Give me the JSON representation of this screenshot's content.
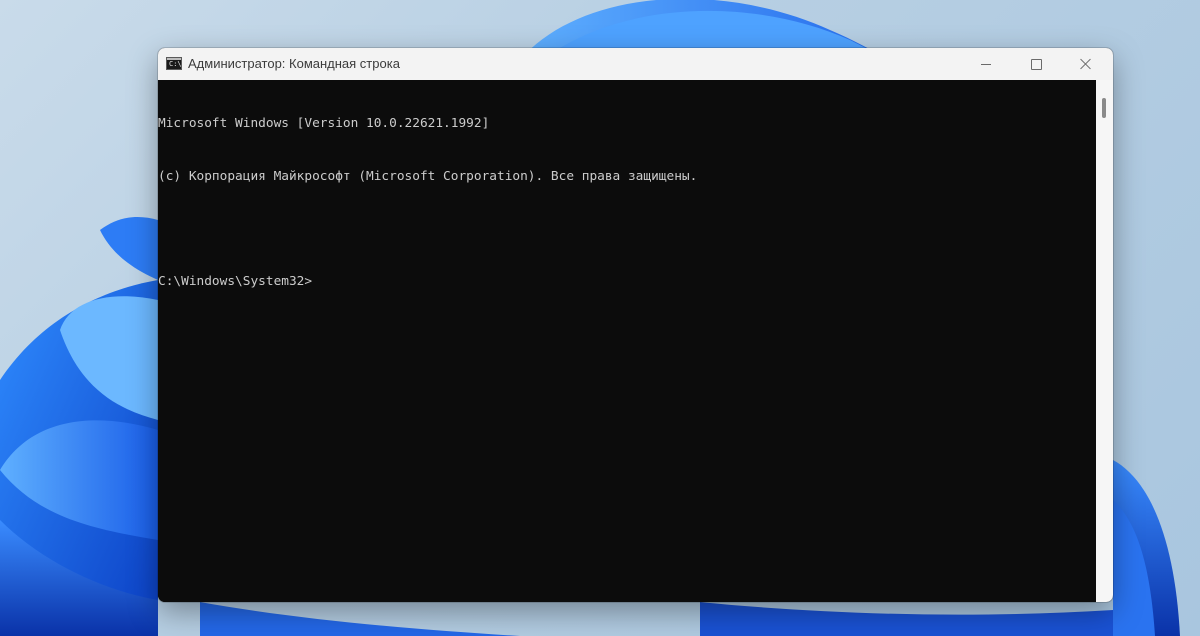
{
  "colors": {
    "console_bg": "#0c0c0c",
    "console_text": "#cccccc",
    "titlebar_bg": "#f3f3f3",
    "accent_blue": "#1a64e6"
  },
  "window": {
    "title": "Администратор: Командная строка",
    "icon": "cmd-prompt-icon",
    "controls": {
      "minimize": "minimize-icon",
      "maximize": "maximize-icon",
      "close": "close-icon"
    }
  },
  "console": {
    "lines": [
      "Microsoft Windows [Version 10.0.22621.1992]",
      "(c) Корпорация Майкрософт (Microsoft Corporation). Все права защищены.",
      "",
      "C:\\Windows\\System32>"
    ]
  }
}
